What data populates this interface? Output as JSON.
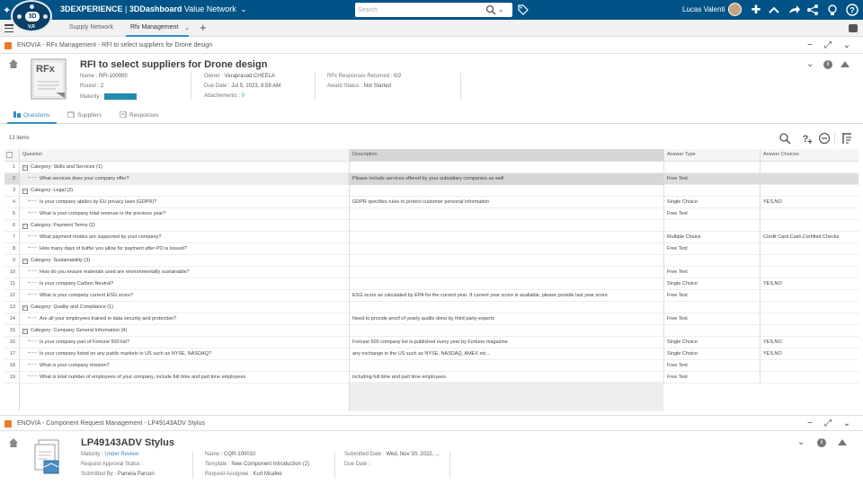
{
  "topbar": {
    "compass_label": "3D",
    "compass_sub": "V,R",
    "brand_3dx": "3DEXPERIENCE",
    "brand_sep": " | ",
    "brand_app": "3DDashboard",
    "brand_dashboard": "Value Network",
    "search_placeholder": "Search",
    "username": "Lucas Valenti",
    "icons": [
      "tag-icon",
      "add-icon",
      "share-icon",
      "network-icon",
      "bulb-icon",
      "help-icon"
    ]
  },
  "tabs": {
    "items": [
      {
        "label": "Supply Network"
      },
      {
        "label": "Rfx Management"
      }
    ]
  },
  "widget1": {
    "header_title": "ENOVIA - RFx Management - RFI to select suppliers for Drone design",
    "doc_badge": "RFx",
    "title": "RFI to select suppliers for Drone design",
    "fields": {
      "name_label": "Name",
      "name_value": ": RFI-100000",
      "round_label": "Round",
      "round_value": ": 2",
      "maturity_label": "Maturity",
      "maturity_value": ":",
      "owner_label": "Owner",
      "owner_value": ": Varaprasad CHEELA",
      "due_label": "Due Date",
      "due_value": ": Jul 5, 2023, 8:59 AM",
      "attach_label": "Attachements",
      "attach_value": "0",
      "responses_label": "RFx Responses Returned",
      "responses_value": ": 0/2",
      "award_label": "Award Status",
      "award_value": ": Not Started"
    },
    "subtabs": [
      "Questions",
      "Suppliers",
      "Responses"
    ],
    "items_count": "13 items",
    "columns": [
      "Question",
      "Description",
      "Answer Type",
      "Answer Choices"
    ],
    "rows": [
      {
        "n": "1",
        "type": "cat",
        "q": "Category: Skills and Services (1)",
        "d": "",
        "t": "",
        "c": ""
      },
      {
        "n": "2",
        "type": "q",
        "q": "What services does your company offer?",
        "d": "Please include services offered by your subsidiary companies as well",
        "t": "Free Text",
        "c": ""
      },
      {
        "n": "3",
        "type": "cat",
        "q": "Category: Legal (2)",
        "d": "",
        "t": "",
        "c": ""
      },
      {
        "n": "4",
        "type": "q",
        "q": "Is your company abides by EU privacy laws (GDPR)?",
        "d": "GDPR specifies rules to protect customer personal information",
        "t": "Single Choice",
        "c": "YES,NO"
      },
      {
        "n": "5",
        "type": "q",
        "q": "What is your company total revenue in the previous year?",
        "d": "",
        "t": "Free Text",
        "c": ""
      },
      {
        "n": "6",
        "type": "cat",
        "q": "Category: Payment Terms (2)",
        "d": "",
        "t": "",
        "c": ""
      },
      {
        "n": "7",
        "type": "q",
        "q": "What payment modes are supported by your company?",
        "d": "",
        "t": "Multiple Choice",
        "c": "Credit Card,Cash,Certified Checks"
      },
      {
        "n": "8",
        "type": "q",
        "q": "How many days of buffer you allow for payment after PO is issued?",
        "d": "",
        "t": "Free Text",
        "c": ""
      },
      {
        "n": "9",
        "type": "cat",
        "q": "Category: Sustainability (3)",
        "d": "",
        "t": "",
        "c": ""
      },
      {
        "n": "10",
        "type": "q",
        "q": "How do you ensure materials used are environmentally sustainable?",
        "d": "",
        "t": "Free Text",
        "c": ""
      },
      {
        "n": "11",
        "type": "q",
        "q": "Is your company Carbon Neutral?",
        "d": "",
        "t": "Single Choice",
        "c": "YES,NO"
      },
      {
        "n": "12",
        "type": "q",
        "q": "What is your company current ESG score?",
        "d": "ESG score as calculated by EPA for the current year. If current year score is available, please provide last year score",
        "t": "Free Text",
        "c": ""
      },
      {
        "n": "13",
        "type": "cat",
        "q": "Category: Quality and Compliance (1)",
        "d": "",
        "t": "",
        "c": ""
      },
      {
        "n": "14",
        "type": "q",
        "q": "Are all your employees trained in data security and protection?",
        "d": "Need to provide proof of yearly audits done by third party experts",
        "t": "Free Text",
        "c": ""
      },
      {
        "n": "15",
        "type": "cat",
        "q": "Category: Company General Information (4)",
        "d": "",
        "t": "",
        "c": ""
      },
      {
        "n": "16",
        "type": "q",
        "q": "Is your company part of Fortune 500 list?",
        "d": "Fortune 500 company list is published every year by Fortune magazine",
        "t": "Single Choice",
        "c": "YES,NO"
      },
      {
        "n": "17",
        "type": "q",
        "q": "Is your company listed on any public markets in US such as NYSE, NASDAQ?",
        "d": "any exchange in the US such as NYSE, NASDAQ, AMEX etc...",
        "t": "Single Choice",
        "c": "YES,NO"
      },
      {
        "n": "18",
        "type": "q",
        "q": "What is your company mission?",
        "d": "",
        "t": "Free Text",
        "c": ""
      },
      {
        "n": "19",
        "type": "q",
        "q": "What is total number of employees of your company, include full time and part time employees",
        "d": "including full time and part time employees",
        "t": "Free Text",
        "c": ""
      }
    ]
  },
  "widget2": {
    "header_title": "ENOVIA - Component Request Management - LP49143ADV Stylus",
    "title": "LP49143ADV Stylus",
    "fields": {
      "maturity_label": "Maturity",
      "maturity_value": "Under Review",
      "approval_label": "Request Approval Status",
      "approval_value": ":",
      "submitted_by_label": "Submitted By",
      "submitted_by_value": ": Pamela Parson",
      "name_label": "Name",
      "name_value": ": CQR-100010",
      "template_label": "Template",
      "template_value": ": New Component Introduction (2)",
      "assignee_label": "Request Assignee",
      "assignee_value": ": Kurt Mcafee",
      "submitted_date_label": "Submitted Date",
      "submitted_date_value": ": Wed, Nov 30, 2022, ...",
      "due_label": "Due Date",
      "due_value": ":"
    }
  },
  "colors": {
    "topbar": "#005386",
    "accent": "#368ec4",
    "widget_icon": "#e87b2a",
    "maturity_badge": "#218bb0"
  }
}
